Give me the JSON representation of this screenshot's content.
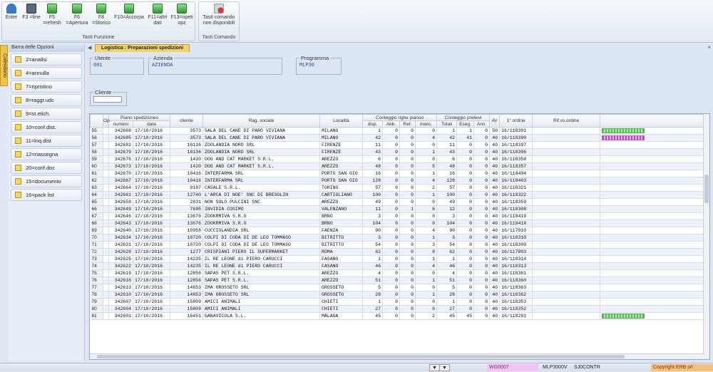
{
  "toolbar": {
    "buttons": [
      {
        "label": "Enter"
      },
      {
        "label": "F3 =fine"
      },
      {
        "label": "F5 =refresh"
      },
      {
        "label": "F6 =Apertura"
      },
      {
        "label": "F8 =Storico"
      },
      {
        "label": "F10=Accorpa"
      },
      {
        "label": "F11=altri dati"
      },
      {
        "label": "F13=ripeti opz"
      }
    ],
    "group_label": "Tasti Funzione",
    "command_button": "Tasti comando non disponibili",
    "command_group_label": "Tasti Comando"
  },
  "side_tab": "Calendario",
  "sidebar": {
    "title": "Barra delle Opzioni",
    "items": [
      {
        "label": "2=analisi"
      },
      {
        "label": "4=annulla"
      },
      {
        "label": "7=ripristino"
      },
      {
        "label": "8=raggr.udc"
      },
      {
        "label": "9=st.etich."
      },
      {
        "label": "10=conf.dist."
      },
      {
        "label": "11=lnq.dist"
      },
      {
        "label": "12=riassegna"
      },
      {
        "label": "20=conf.doc"
      },
      {
        "label": "15=documento"
      },
      {
        "label": "16=pack list"
      }
    ]
  },
  "tab": {
    "label": "Logistica : Preparazioni spedizioni"
  },
  "fields": {
    "utente": {
      "label": "Utente",
      "value": "001"
    },
    "azienda": {
      "label": "Azienda",
      "value": "AZIENDA"
    },
    "programma": {
      "label": "Programma",
      "value": "MLP30"
    },
    "cliente": {
      "label": "Cliente",
      "value": ""
    }
  },
  "grid": {
    "headers": {
      "op": "Op",
      "piano": "Piano spedizioneo",
      "numero": "numero",
      "data": "data",
      "cliente": "cliente",
      "rag": "Rag. sociale",
      "loc": "Località",
      "conteggio_righe": "Conteggio righe pianoo",
      "disp": "disp.",
      "abb": "Abb.",
      "ref": "Ref.",
      "manc": "manc.",
      "conteggio_prelievi": "Conteggio prelievi",
      "totali": "Totali",
      "eseg": "Eseg.",
      "ann": "Ann.",
      "av": "AV",
      "ordine": "1° ordine",
      "rif": "Rif.vs.ordine"
    },
    "rows": [
      [
        "55",
        "342688",
        "17/10/2016",
        "3573",
        "SALA DEL CANE DI PARO VIVIANA",
        "MILANO",
        "1",
        "0",
        "0",
        "0",
        "1",
        "1",
        "0",
        "50",
        "16/118391",
        "green"
      ],
      [
        "56",
        "342685",
        "17/10/2016",
        "3573",
        "SALA DEL CANE DI PARO VIVIANA",
        "MILANO",
        "42",
        "0",
        "0",
        "4",
        "42",
        "41",
        "0",
        "40",
        "16/118390",
        "magenta"
      ],
      [
        "57",
        "342682",
        "17/10/2016",
        "10136",
        "ZOOLANDIA NORD SRL",
        "FIRENZE",
        "11",
        "0",
        "0",
        "0",
        "11",
        "0",
        "0",
        "40",
        "16/118397",
        ""
      ],
      [
        "58",
        "342679",
        "17/10/2016",
        "10136",
        "ZOOLANDIA NORD SRL",
        "FIRENZE",
        "43",
        "0",
        "0",
        "1",
        "43",
        "0",
        "0",
        "40",
        "16/118396",
        ""
      ],
      [
        "59",
        "342676",
        "17/10/2016",
        "1420",
        "DOG AND CAT MARKET S.R.L.",
        "AREZZO",
        "6",
        "0",
        "0",
        "0",
        "6",
        "0",
        "0",
        "40",
        "16/118358",
        ""
      ],
      [
        "60",
        "342673",
        "17/10/2016",
        "1420",
        "DOG AND CAT MARKET S.R.L.",
        "AREZZO",
        "48",
        "0",
        "0",
        "5",
        "48",
        "0",
        "0",
        "40",
        "16/118357",
        ""
      ],
      [
        "61",
        "342670",
        "17/10/2016",
        "10416",
        "INTERFARMA SRL",
        "PORTO SAN GIO",
        "16",
        "0",
        "0",
        "1",
        "16",
        "0",
        "0",
        "40",
        "16/118404",
        ""
      ],
      [
        "62",
        "342667",
        "17/10/2016",
        "10416",
        "INTERFARMA SRL",
        "PORTO SAN GIO",
        "128",
        "0",
        "0",
        "4",
        "128",
        "0",
        "0",
        "40",
        "16/118403",
        ""
      ],
      [
        "63",
        "342664",
        "17/10/2016",
        "9187",
        "CASALE S.R.L.",
        "TORINO",
        "57",
        "0",
        "0",
        "2",
        "57",
        "0",
        "0",
        "40",
        "16/118321",
        ""
      ],
      [
        "64",
        "342661",
        "17/10/2016",
        "12740",
        "L'ARCA DI NOE' SNC DI BRESOLIN",
        "CARTIGLIANO",
        "100",
        "0",
        "0",
        "1",
        "100",
        "0",
        "0",
        "40",
        "16/118322",
        ""
      ],
      [
        "65",
        "342658",
        "17/10/2016",
        "2831",
        "NON SOLO PULCINI SNC",
        "AREZZO",
        "49",
        "0",
        "0",
        "0",
        "49",
        "0",
        "0",
        "40",
        "16/118359",
        ""
      ],
      [
        "66",
        "342649",
        "17/10/2016",
        "7695",
        "INVIDIA COSIMO",
        "VALENZANO",
        "11",
        "0",
        "1",
        "6",
        "12",
        "0",
        "0",
        "40",
        "16/118308",
        ""
      ],
      [
        "67",
        "342646",
        "17/10/2016",
        "13676",
        "ZOOKRMIVA S.R.O",
        "BRNO",
        "3",
        "0",
        "0",
        "0",
        "3",
        "0",
        "0",
        "40",
        "16/118419",
        ""
      ],
      [
        "68",
        "342643",
        "17/10/2016",
        "13676",
        "ZOOKRMIVA S.R.O",
        "BRNO",
        "104",
        "0",
        "0",
        "0",
        "104",
        "0",
        "0",
        "40",
        "16/118418",
        ""
      ],
      [
        "69",
        "342640",
        "17/10/2016",
        "10958",
        "CUCCIOLANDIA SRL",
        "FAENZA",
        "90",
        "0",
        "0",
        "4",
        "90",
        "0",
        "0",
        "40",
        "16/117910",
        ""
      ],
      [
        "70",
        "342634",
        "17/10/2016",
        "10720",
        "COLPI DI CODA DI DE LEO TOMMASO",
        "BITRITTO",
        "3",
        "0",
        "0",
        "1",
        "3",
        "0",
        "0",
        "40",
        "16/118310",
        ""
      ],
      [
        "71",
        "342631",
        "17/10/2016",
        "10720",
        "COLPI DI CODA DI DE LEO TOMMASO",
        "BITRITTO",
        "54",
        "0",
        "0",
        "3",
        "54",
        "0",
        "0",
        "40",
        "16/118309",
        ""
      ],
      [
        "72",
        "342628",
        "17/10/2016",
        "1277",
        "CRISPIANI PIERO IL SUPERMARKET",
        "ROMA",
        "62",
        "0",
        "0",
        "8",
        "62",
        "0",
        "0",
        "40",
        "16/117803",
        ""
      ],
      [
        "73",
        "342625",
        "17/10/2016",
        "14235",
        "IL RE LEONE di PIERO CARUCCI",
        "FASANO",
        "1",
        "0",
        "0",
        "1",
        "1",
        "0",
        "0",
        "40",
        "16/118314",
        ""
      ],
      [
        "74",
        "342622",
        "17/10/2016",
        "14235",
        "IL RE LEONE di PIERO CARUCCI",
        "FASANO",
        "46",
        "0",
        "0",
        "4",
        "46",
        "0",
        "0",
        "40",
        "16/118313",
        ""
      ],
      [
        "75",
        "342619",
        "17/10/2016",
        "12856",
        "SAPAS PET S.R.L.",
        "AREZZO",
        "4",
        "0",
        "0",
        "0",
        "4",
        "0",
        "0",
        "40",
        "16/118361",
        ""
      ],
      [
        "76",
        "342616",
        "17/10/2016",
        "12856",
        "SAPAS PET S.R.L.",
        "AREZZO",
        "51",
        "0",
        "0",
        "1",
        "51",
        "0",
        "0",
        "40",
        "16/118360",
        ""
      ],
      [
        "77",
        "342613",
        "17/10/2016",
        "14853",
        "IMA GROSSETO SRL",
        "GROSSETO",
        "5",
        "0",
        "0",
        "0",
        "5",
        "0",
        "0",
        "40",
        "16/118363",
        ""
      ],
      [
        "78",
        "342610",
        "17/10/2016",
        "14853",
        "IMA GROSSETO SRL",
        "GROSSETO",
        "28",
        "0",
        "0",
        "1",
        "28",
        "0",
        "0",
        "40",
        "16/118362",
        ""
      ],
      [
        "79",
        "342607",
        "17/10/2016",
        "15809",
        "AMICI ANIMALI",
        "CHIETI",
        "1",
        "0",
        "0",
        "0",
        "1",
        "0",
        "0",
        "40",
        "16/118353",
        ""
      ],
      [
        "80",
        "342604",
        "17/10/2016",
        "15809",
        "AMICI ANIMALI",
        "CHIETI",
        "27",
        "0",
        "0",
        "0",
        "27",
        "0",
        "0",
        "40",
        "16/118352",
        ""
      ],
      [
        "81",
        "342601",
        "17/10/2016",
        "16451",
        "GANAVICOLA S.L.",
        "MÁLAGA",
        "45",
        "0",
        "0",
        "2",
        "45",
        "45",
        "0",
        "40",
        "16/118291",
        "green"
      ]
    ]
  },
  "statusbar": {
    "s1": "WG0007",
    "s2": "MLP3000V",
    "s3": "SJ0CONTR",
    "copyright": "Copyright ERB srl"
  }
}
